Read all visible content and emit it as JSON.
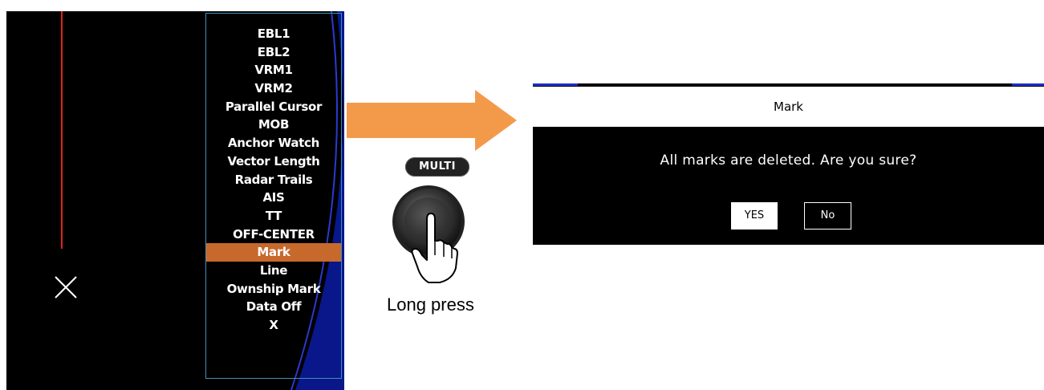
{
  "menu": {
    "items": [
      {
        "label": "EBL1"
      },
      {
        "label": "EBL2"
      },
      {
        "label": "VRM1"
      },
      {
        "label": "VRM2"
      },
      {
        "label": "Parallel Cursor"
      },
      {
        "label": "MOB"
      },
      {
        "label": "Anchor Watch"
      },
      {
        "label": "Vector Length"
      },
      {
        "label": "Radar Trails"
      },
      {
        "label": "AIS"
      },
      {
        "label": "TT"
      },
      {
        "label": "OFF-CENTER"
      },
      {
        "label": "Mark",
        "selected": true
      },
      {
        "label": "Line"
      },
      {
        "label": "Ownship Mark"
      },
      {
        "label": "Data Off"
      },
      {
        "label": "X"
      }
    ]
  },
  "knob": {
    "badge": "MULTI",
    "caption": "Long press"
  },
  "dialog": {
    "title": "Mark",
    "message": "All marks are deleted. Are you sure?",
    "yes_label": "YES",
    "no_label": "No"
  },
  "colors": {
    "highlight": "#c8692c",
    "arrow": "#f39a4a",
    "menu_border": "#3f8fb8",
    "cursor_line": "#e0201a",
    "accent_blue": "#1f2ec8"
  }
}
